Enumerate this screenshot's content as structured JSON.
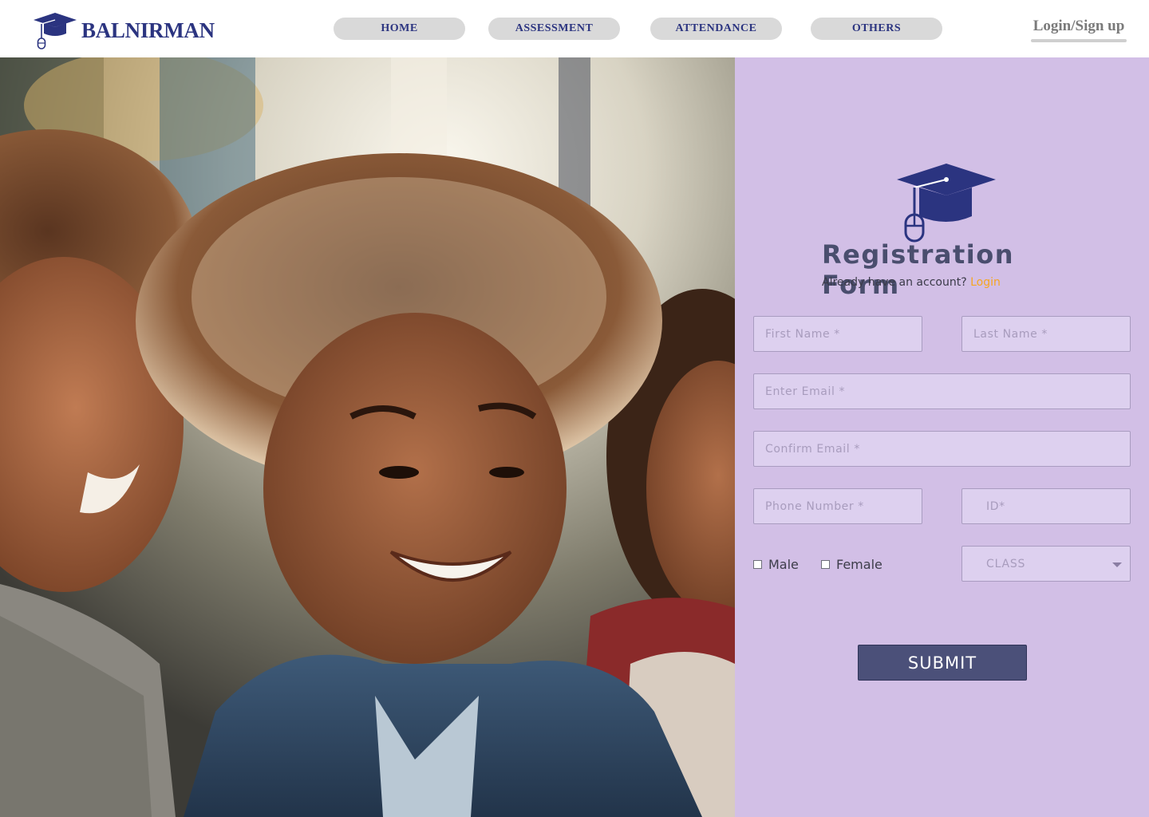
{
  "brand": {
    "name": "BALNIRMAN"
  },
  "nav": {
    "items": [
      {
        "label": "HOME"
      },
      {
        "label": "ASSESSMENT"
      },
      {
        "label": "ATTENDANCE"
      },
      {
        "label": "OTHERS"
      }
    ],
    "login_label": "Login/Sign up"
  },
  "form": {
    "title": "Registration Form",
    "subtitle": "Already have an account?",
    "login_link": "Login",
    "first_name_placeholder": "First Name *",
    "last_name_placeholder": "Last Name *",
    "email_placeholder": "Enter Email *",
    "confirm_email_placeholder": "Confirm Email *",
    "phone_placeholder": "Phone Number *",
    "id_placeholder": "ID*",
    "gender_options": [
      "Male",
      "Female"
    ],
    "class_select": "CLASS",
    "submit_label": "SUBMIT"
  },
  "colors": {
    "brand": "#2b3480",
    "panel": "#d2bfe6",
    "accent_link": "#f5a623",
    "submit": "#4b5079"
  },
  "icons": {
    "logo": "graduation-cap-mouse-icon",
    "select_caret": "chevron-down-icon"
  }
}
